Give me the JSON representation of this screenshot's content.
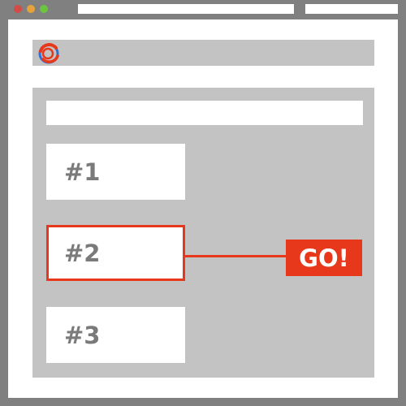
{
  "browser": {
    "window_controls": [
      "close",
      "minimize",
      "maximize"
    ]
  },
  "header": {
    "logo_icon": "circular-swirl-logo-icon",
    "accent_colors": [
      "#2f6fd6",
      "#e8381b"
    ]
  },
  "main": {
    "items": [
      {
        "label": "#1",
        "selected": false
      },
      {
        "label": "#2",
        "selected": true
      },
      {
        "label": "#3",
        "selected": false
      }
    ],
    "action": {
      "label": "GO!"
    }
  },
  "colors": {
    "accent": "#e8381b",
    "panel": "#c3c3c3",
    "frame": "#808080",
    "card_text": "#7a7a7a"
  }
}
